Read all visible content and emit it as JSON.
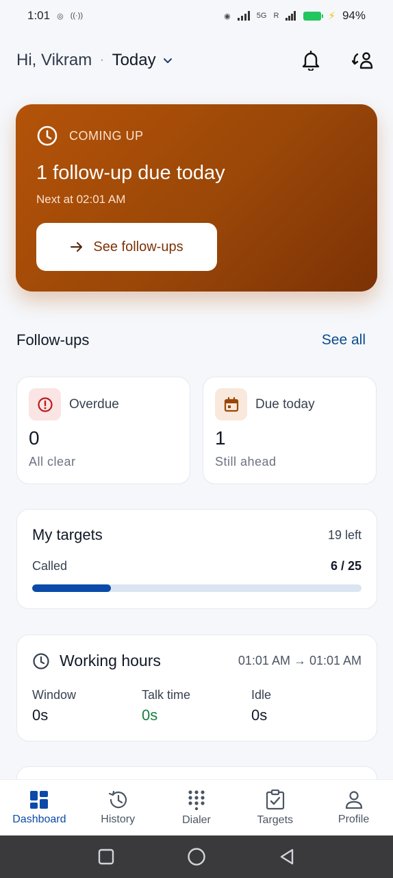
{
  "status_bar": {
    "time": "1:01",
    "network": "5G",
    "roaming": "R",
    "battery": "94%"
  },
  "header": {
    "greeting": "Hi, Vikram",
    "separator": "·",
    "period": "Today",
    "icons": [
      "bell-icon",
      "swap-user-icon"
    ]
  },
  "hero": {
    "kicker": "COMING UP",
    "title": "1 follow-up due today",
    "subtitle": "Next at 02:01 AM",
    "button_label": "See follow-ups",
    "colors": {
      "start": "#b45309",
      "end": "#7c3206"
    }
  },
  "followups": {
    "title": "Follow-ups",
    "see_all": "See all",
    "cards": [
      {
        "label": "Overdue",
        "count": "0",
        "note": "All clear",
        "icon": "alert-circle-icon"
      },
      {
        "label": "Due today",
        "count": "1",
        "note": "Still ahead",
        "icon": "calendar-icon"
      }
    ]
  },
  "targets": {
    "title": "My targets",
    "left": "19 left",
    "called_label": "Called",
    "called_value": "6 / 25",
    "progress_fraction": 0.24,
    "accent": "#0b4aa8"
  },
  "working_hours": {
    "title": "Working hours",
    "range": "01:01 AM → 01:01 AM",
    "metrics": [
      {
        "label": "Window",
        "value": "0s"
      },
      {
        "label": "Talk time",
        "value": "0s"
      },
      {
        "label": "Idle",
        "value": "0s"
      }
    ]
  },
  "bottom_nav": {
    "items": [
      {
        "label": "Dashboard",
        "icon": "dashboard-icon",
        "active": true
      },
      {
        "label": "History",
        "icon": "history-icon",
        "active": false
      },
      {
        "label": "Dialer",
        "icon": "dialpad-icon",
        "active": false
      },
      {
        "label": "Targets",
        "icon": "clipboard-check-icon",
        "active": false
      },
      {
        "label": "Profile",
        "icon": "person-icon",
        "active": false
      }
    ]
  }
}
